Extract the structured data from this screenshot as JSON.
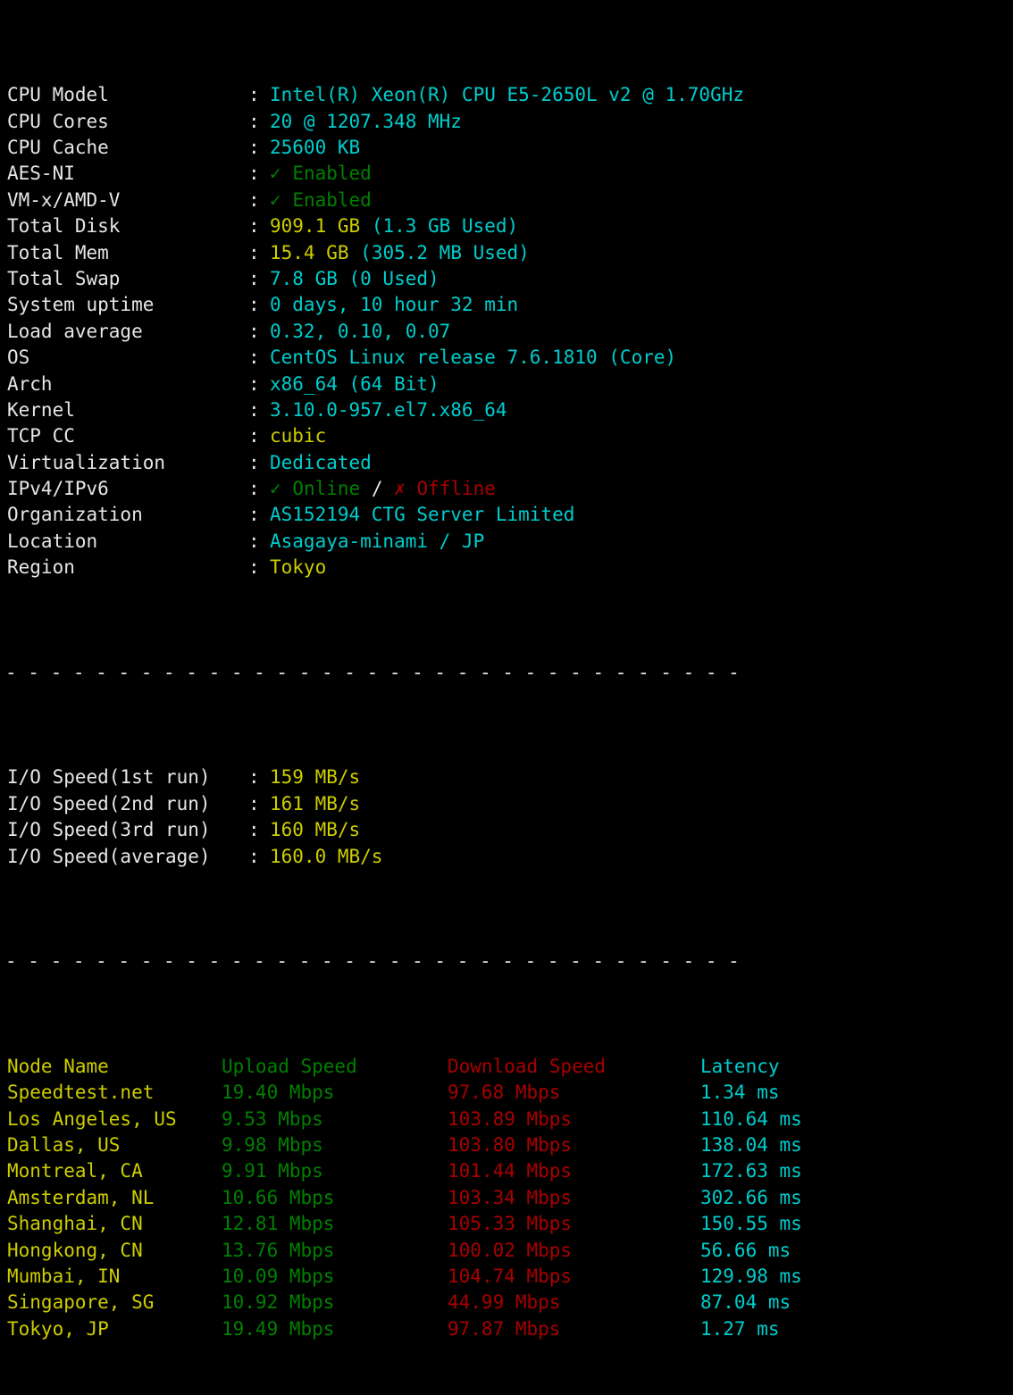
{
  "terminal": {
    "background": "#000000",
    "foreground": "#e6e6e6",
    "colors": {
      "cyan": "#00cdcd",
      "yellow": "#cdcd00",
      "green": "#008000",
      "red": "#a80000",
      "white": "#e6e6e6"
    },
    "divider": "- - - - - - - - - - - - - - - - - - - - - - - - - - - - - - - - -"
  },
  "system_info": {
    "colon": ":",
    "rows": [
      {
        "label": "CPU Model",
        "value": "Intel(R) Xeon(R) CPU E5-2650L v2 @ 1.70GHz",
        "color": "cyan"
      },
      {
        "label": "CPU Cores",
        "value": "20 @ 1207.348 MHz",
        "color": "cyan"
      },
      {
        "label": "CPU Cache",
        "value": "25600 KB",
        "color": "cyan"
      },
      {
        "label": "AES-NI",
        "value": "Enabled",
        "icon": "✓",
        "color": "green"
      },
      {
        "label": "VM-x/AMD-V",
        "value": "Enabled",
        "icon": "✓",
        "color": "green"
      },
      {
        "label": "Total Disk",
        "value_primary": "909.1 GB",
        "value_secondary": "(1.3 GB Used)",
        "color": "yellow",
        "secondary_color": "cyan"
      },
      {
        "label": "Total Mem",
        "value_primary": "15.4 GB",
        "value_secondary": "(305.2 MB Used)",
        "color": "yellow",
        "secondary_color": "cyan"
      },
      {
        "label": "Total Swap",
        "value": "7.8 GB (0 Used)",
        "color": "cyan"
      },
      {
        "label": "System uptime",
        "value": "0 days, 10 hour 32 min",
        "color": "cyan"
      },
      {
        "label": "Load average",
        "value": "0.32, 0.10, 0.07",
        "color": "cyan"
      },
      {
        "label": "OS",
        "value": "CentOS Linux release 7.6.1810 (Core)",
        "color": "cyan"
      },
      {
        "label": "Arch",
        "value": "x86_64 (64 Bit)",
        "color": "cyan"
      },
      {
        "label": "Kernel",
        "value": "3.10.0-957.el7.x86_64",
        "color": "cyan"
      },
      {
        "label": "TCP CC",
        "value": "cubic",
        "color": "yellow"
      },
      {
        "label": "Virtualization",
        "value": "Dedicated",
        "color": "cyan"
      },
      {
        "label": "IPv4/IPv6",
        "ipv4_icon": "✓",
        "ipv4": "Online",
        "separator": "/",
        "ipv6_icon": "✗",
        "ipv6": "Offline",
        "color": "mixed"
      },
      {
        "label": "Organization",
        "value": "AS152194 CTG Server Limited",
        "color": "cyan"
      },
      {
        "label": "Location",
        "value": "Asagaya-minami / JP",
        "color": "cyan"
      },
      {
        "label": "Region",
        "value": "Tokyo",
        "color": "yellow"
      }
    ]
  },
  "io_speed": {
    "colon": ":",
    "rows": [
      {
        "label": "I/O Speed(1st run)",
        "value": "159 MB/s"
      },
      {
        "label": "I/O Speed(2nd run)",
        "value": "161 MB/s"
      },
      {
        "label": "I/O Speed(3rd run)",
        "value": "160 MB/s"
      },
      {
        "label": "I/O Speed(average)",
        "value": "160.0 MB/s"
      }
    ]
  },
  "speedtest": {
    "headers": {
      "node": "Node Name",
      "upload": "Upload Speed",
      "download": "Download Speed",
      "latency": "Latency"
    },
    "rows": [
      {
        "node": "Speedtest.net",
        "upload": "19.40 Mbps",
        "download": "97.68 Mbps",
        "latency": "1.34 ms"
      },
      {
        "node": "Los Angeles, US",
        "upload": "9.53 Mbps",
        "download": "103.89 Mbps",
        "latency": "110.64 ms"
      },
      {
        "node": "Dallas, US",
        "upload": "9.98 Mbps",
        "download": "103.80 Mbps",
        "latency": "138.04 ms"
      },
      {
        "node": "Montreal, CA",
        "upload": "9.91 Mbps",
        "download": "101.44 Mbps",
        "latency": "172.63 ms"
      },
      {
        "node": "Amsterdam, NL",
        "upload": "10.66 Mbps",
        "download": "103.34 Mbps",
        "latency": "302.66 ms"
      },
      {
        "node": "Shanghai, CN",
        "upload": "12.81 Mbps",
        "download": "105.33 Mbps",
        "latency": "150.55 ms"
      },
      {
        "node": "Hongkong, CN",
        "upload": "13.76 Mbps",
        "download": "100.02 Mbps",
        "latency": "56.66 ms"
      },
      {
        "node": "Mumbai, IN",
        "upload": "10.09 Mbps",
        "download": "104.74 Mbps",
        "latency": "129.98 ms"
      },
      {
        "node": "Singapore, SG",
        "upload": "10.92 Mbps",
        "download": "44.99 Mbps",
        "latency": "87.04 ms"
      },
      {
        "node": "Tokyo, JP",
        "upload": "19.49 Mbps",
        "download": "97.87 Mbps",
        "latency": "1.27 ms"
      }
    ]
  }
}
